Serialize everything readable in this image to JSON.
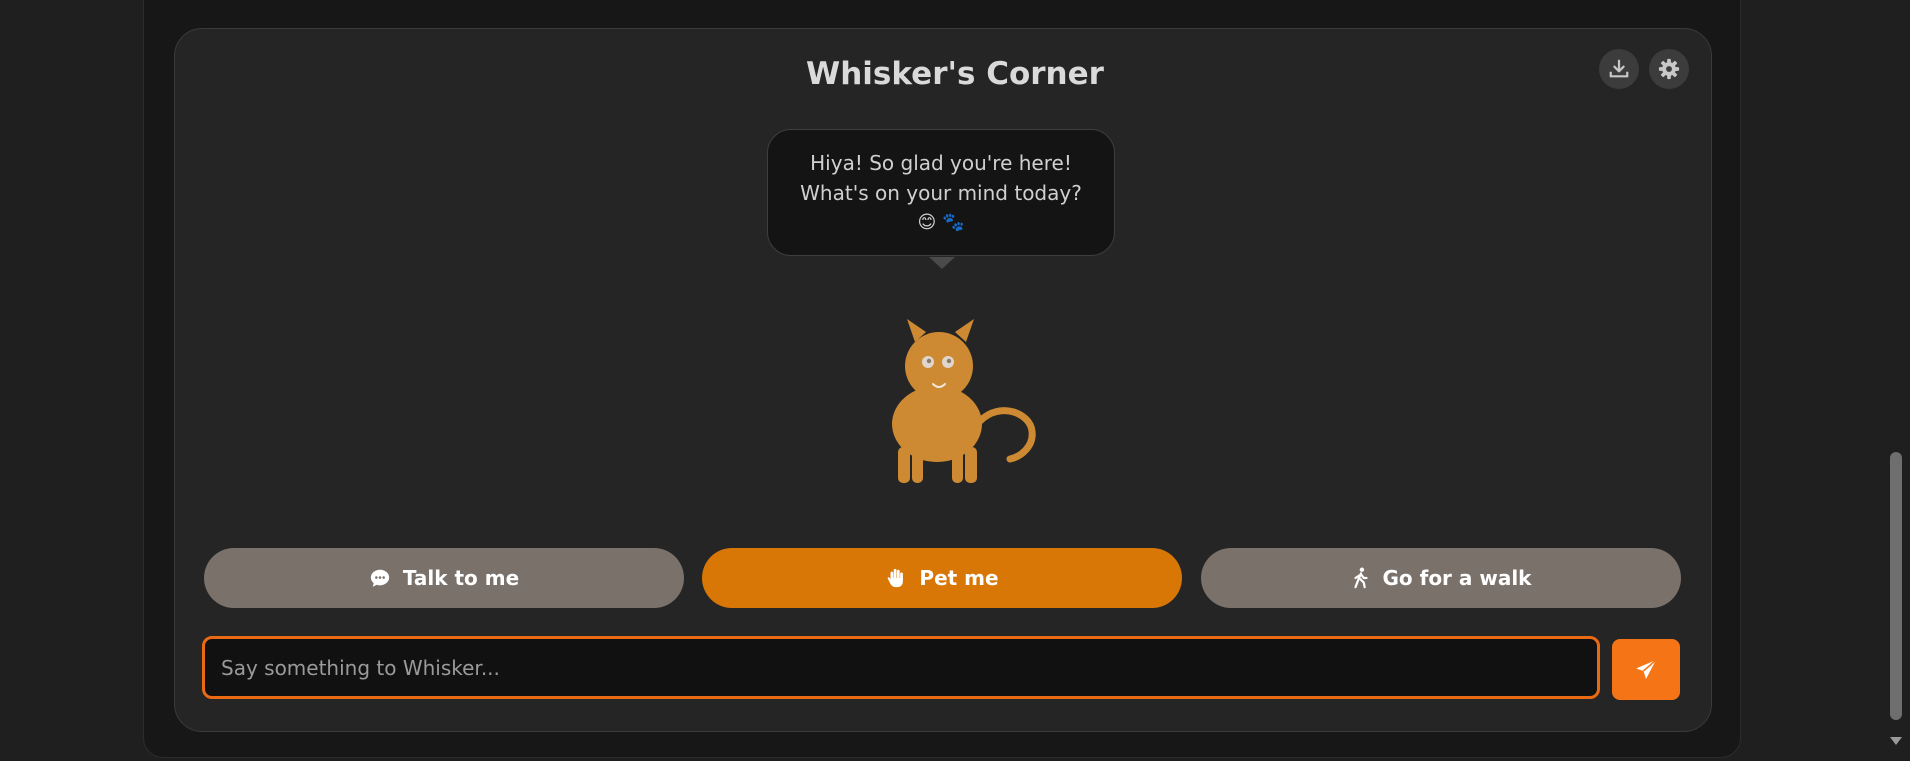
{
  "app": {
    "title": "Whisker's Corner"
  },
  "toolbar": {
    "download_icon": "download-icon",
    "settings_icon": "gear-icon"
  },
  "speech_bubble": {
    "line1": "Hiya! So glad you're here!",
    "line2": "What's on your mind today?",
    "emoji": "😊 🐾"
  },
  "actions": {
    "talk_label": "Talk to me",
    "talk_icon": "chat-bubble-icon",
    "pet_label": "Pet me",
    "pet_icon": "hand-icon",
    "walk_label": "Go for a walk",
    "walk_icon": "walking-person-icon"
  },
  "chat": {
    "placeholder": "Say something to Whisker...",
    "value": "",
    "send_icon": "paper-plane-icon"
  },
  "colors": {
    "accent": "#d97706",
    "send_button": "#f47416",
    "input_border": "#ea6a14",
    "secondary_button": "#7a716b",
    "cat": "#cd8a33",
    "background": "#1f1f1f",
    "card": "#252525"
  }
}
